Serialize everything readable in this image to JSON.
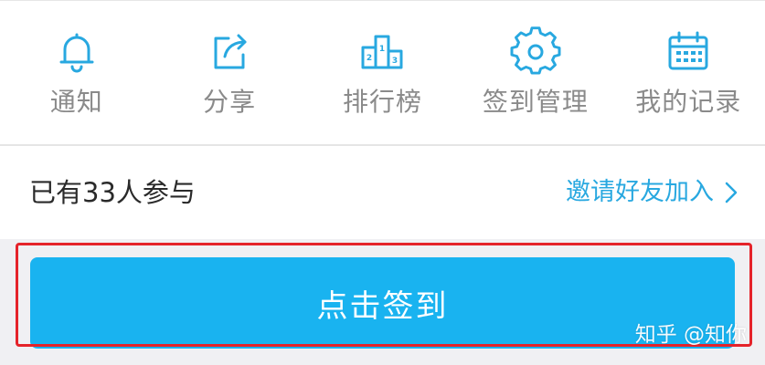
{
  "toolbar": {
    "items": [
      {
        "label": "通知",
        "icon": "bell-icon"
      },
      {
        "label": "分享",
        "icon": "share-icon"
      },
      {
        "label": "排行榜",
        "icon": "podium-icon"
      },
      {
        "label": "签到管理",
        "icon": "gear-icon"
      },
      {
        "label": "我的记录",
        "icon": "calendar-icon"
      }
    ]
  },
  "info": {
    "participants": "已有33人参与",
    "invite": "邀请好友加入"
  },
  "action": {
    "checkin_label": "点击签到"
  },
  "watermark": "知乎 @知你",
  "colors": {
    "accent": "#19b3f0",
    "icon": "#28a8e0",
    "highlight": "#e5232a"
  }
}
